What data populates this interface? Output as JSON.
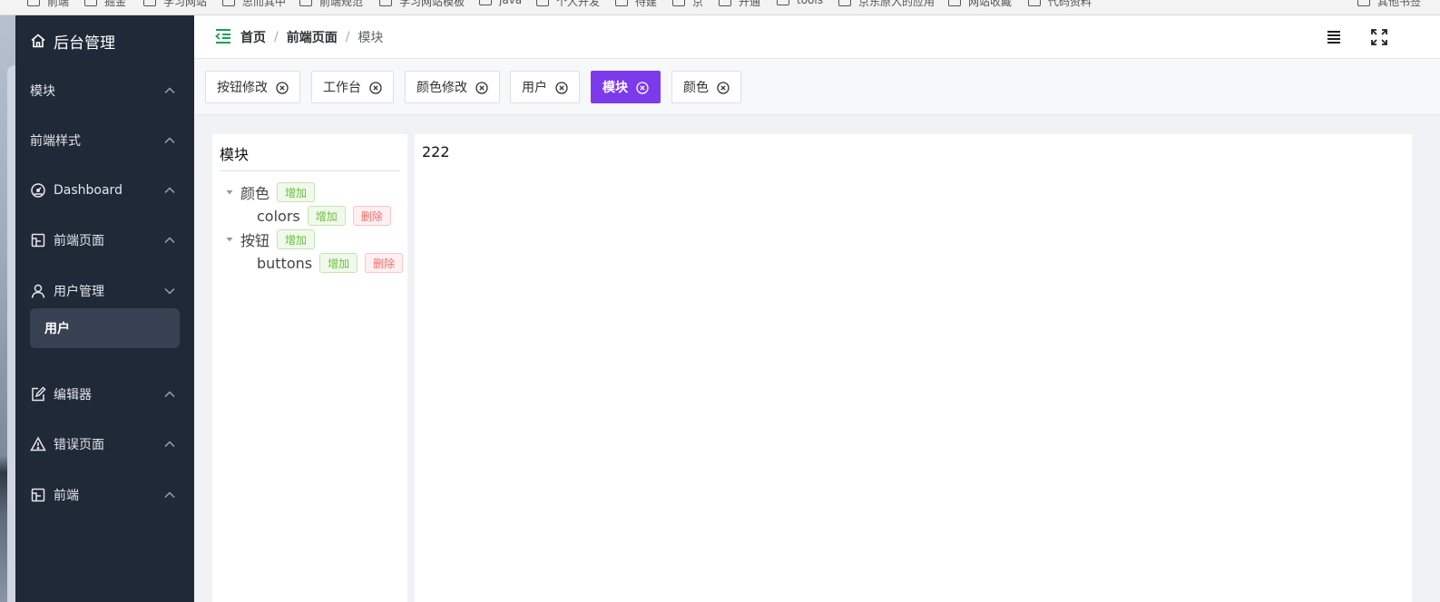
{
  "bookmarks": [
    "前端",
    "掘金",
    "学习网站",
    "思而其中",
    "前端规范",
    "学习网站模板",
    "java",
    "个人开发",
    "待建",
    "京",
    "开通",
    "tools",
    "京东原入的应用",
    "网站收藏",
    "代码资料",
    "其他书签"
  ],
  "sidebar": {
    "title": "后台管理",
    "items": [
      {
        "label": "模块",
        "icon": "none"
      },
      {
        "label": "前端样式",
        "icon": "none"
      },
      {
        "label": "Dashboard",
        "icon": "dashboard-icon"
      },
      {
        "label": "前端页面",
        "icon": "page-icon"
      },
      {
        "label": "用户管理",
        "icon": "user-icon",
        "expanded": true
      },
      {
        "label": "编辑器",
        "icon": "edit-icon"
      },
      {
        "label": "错误页面",
        "icon": "warning-icon"
      },
      {
        "label": "前端",
        "icon": "page-icon"
      }
    ],
    "active_sub_item": "用户"
  },
  "header": {
    "breadcrumb": [
      "首页",
      "前端页面",
      "模块"
    ],
    "separator": "/"
  },
  "tags": [
    {
      "label": "按钮修改",
      "active": false
    },
    {
      "label": "工作台",
      "active": false
    },
    {
      "label": "颜色修改",
      "active": false
    },
    {
      "label": "用户",
      "active": false
    },
    {
      "label": "模块",
      "active": true
    },
    {
      "label": "颜色",
      "active": false
    }
  ],
  "tree_panel": {
    "title": "模块",
    "add_label": "增加",
    "delete_label": "删除",
    "nodes": [
      {
        "label": "颜色",
        "children": [
          {
            "label": "colors"
          }
        ]
      },
      {
        "label": "按钮",
        "children": [
          {
            "label": "buttons"
          }
        ]
      }
    ]
  },
  "main_panel": {
    "text": "222"
  },
  "colors": {
    "sidebar_bg": "#1f2937",
    "sidebar_active": "#374151",
    "accent": "#7c3aed",
    "collapse_icon": "#16a34a",
    "add_green": "#67c23a",
    "delete_red": "#f56c6c"
  }
}
